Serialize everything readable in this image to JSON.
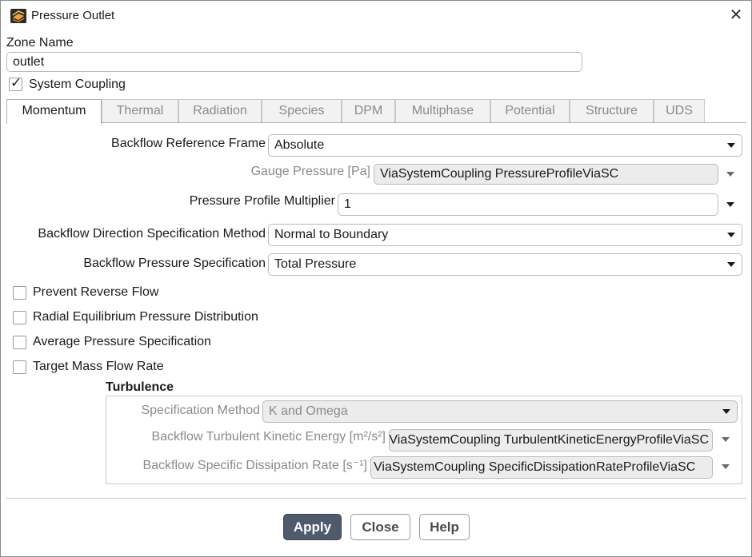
{
  "window": {
    "title": "Pressure Outlet",
    "icon": "fluent-app-icon"
  },
  "zone": {
    "label": "Zone Name",
    "value": "outlet"
  },
  "system_coupling": {
    "label": "System Coupling",
    "checked": true
  },
  "tabs": [
    {
      "label": "Momentum",
      "active": true
    },
    {
      "label": "Thermal"
    },
    {
      "label": "Radiation"
    },
    {
      "label": "Species"
    },
    {
      "label": "DPM"
    },
    {
      "label": "Multiphase"
    },
    {
      "label": "Potential"
    },
    {
      "label": "Structure"
    },
    {
      "label": "UDS"
    }
  ],
  "momentum": {
    "backflow_ref_frame": {
      "label": "Backflow Reference Frame",
      "value": "Absolute"
    },
    "gauge_pressure": {
      "label": "Gauge Pressure [Pa]",
      "value": "ViaSystemCoupling PressureProfileViaSC"
    },
    "pressure_multiplier": {
      "label": "Pressure Profile Multiplier",
      "value": "1"
    },
    "backflow_dir_method": {
      "label": "Backflow Direction Specification Method",
      "value": "Normal to Boundary"
    },
    "backflow_pressure_spec": {
      "label": "Backflow Pressure Specification",
      "value": "Total Pressure"
    },
    "checkboxes": {
      "prevent_reverse_flow": {
        "label": "Prevent Reverse Flow",
        "checked": false
      },
      "radial_equilibrium": {
        "label": "Radial Equilibrium Pressure Distribution",
        "checked": false
      },
      "average_pressure": {
        "label": "Average Pressure Specification",
        "checked": false
      },
      "target_mass_flow": {
        "label": "Target Mass Flow Rate",
        "checked": false
      }
    }
  },
  "turbulence": {
    "title": "Turbulence",
    "spec_method": {
      "label": "Specification Method",
      "value": "K and Omega"
    },
    "tke": {
      "label": "Backflow Turbulent Kinetic Energy [m²/s²]",
      "value": "ViaSystemCoupling TurbulentKineticEnergyProfileViaSC"
    },
    "sdr": {
      "label": "Backflow Specific Dissipation Rate [s⁻¹]",
      "value": "ViaSystemCoupling SpecificDissipationRateProfileViaSC"
    }
  },
  "buttons": {
    "apply": "Apply",
    "close": "Close",
    "help": "Help"
  },
  "colors": {
    "primary_button": "#4f5b6c",
    "disabled_text": "#8a8a8a",
    "readonly_field": "#ececec"
  }
}
